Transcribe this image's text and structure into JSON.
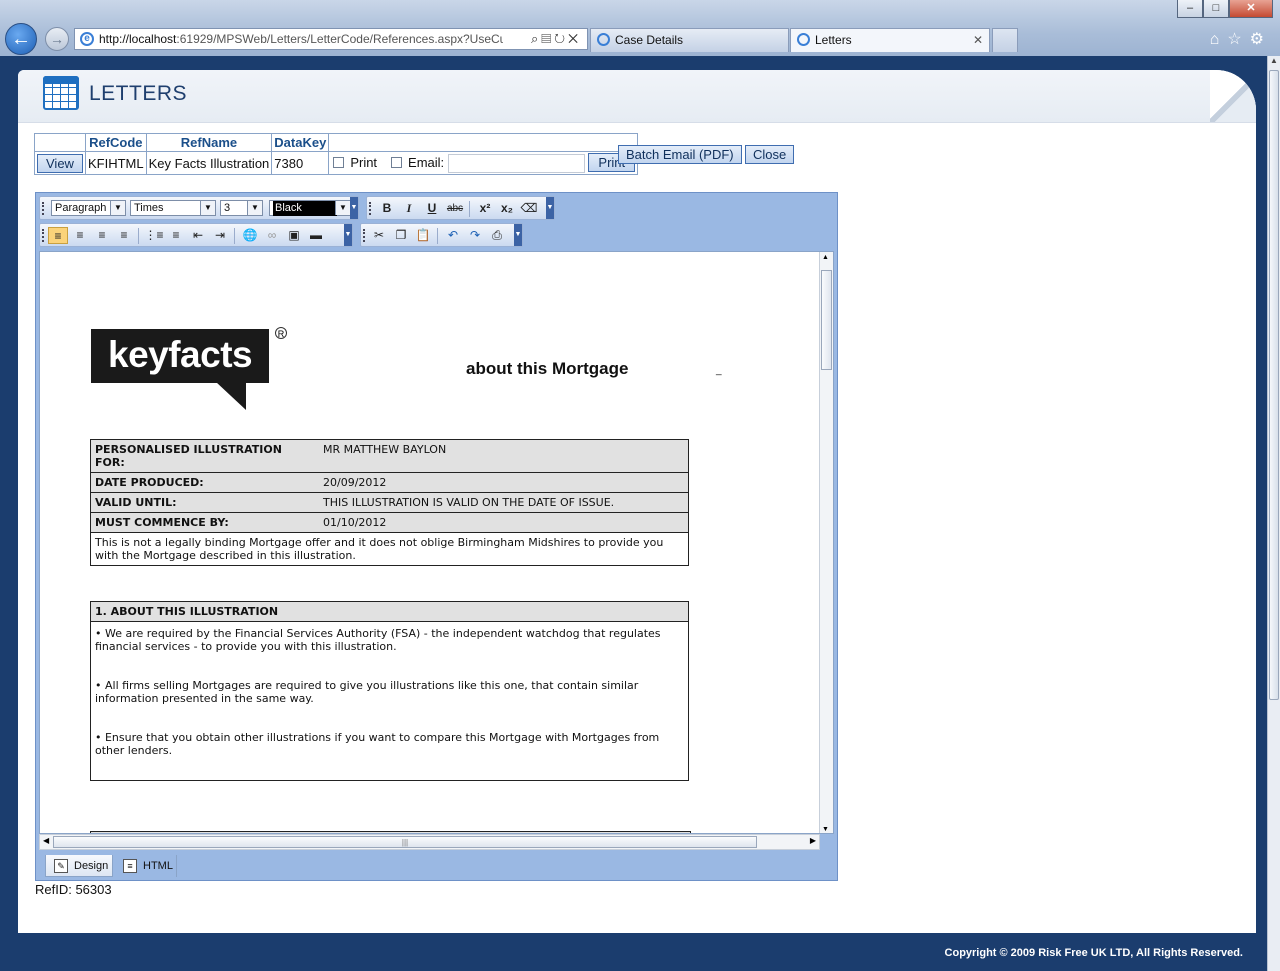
{
  "browser": {
    "url_host": "http://localhost",
    "url_rest": ":61929/MPSWeb/Letters/LetterCode/References.aspx?UseCu",
    "tabs": [
      {
        "label": "Case Details"
      },
      {
        "label": "Letters"
      }
    ],
    "window_controls": {
      "minimize": "–",
      "maximize": "□",
      "close": "✕"
    }
  },
  "header": {
    "title": "LETTERS"
  },
  "ref_table": {
    "columns": [
      "RefCode",
      "RefName",
      "DataKey"
    ],
    "view_button": "View",
    "row": {
      "ref_code": "KFIHTML",
      "ref_name": "Key Facts Illustration",
      "data_key": "7380"
    },
    "print_label": "Print",
    "email_label": "Email:",
    "print_button": "Print"
  },
  "actions": {
    "batch_email": "Batch Email (PDF)",
    "close": "Close"
  },
  "editor": {
    "paragraph_select": "Paragraph",
    "font_select": "Times",
    "size_select": "3",
    "color_select": "Black",
    "modes": [
      "Design",
      "HTML"
    ],
    "icons": {
      "bold": "bold-icon",
      "italic": "italic-icon",
      "underline": "underline-icon",
      "strike": "strikethrough-icon",
      "superscript": "superscript-icon",
      "subscript": "subscript-icon",
      "eraser": "eraser-icon"
    }
  },
  "document": {
    "logo_text": "keyfacts",
    "logo_reg": "R",
    "title": "about this Mortgage",
    "tiny_mark": "_",
    "details": [
      {
        "label": "PERSONALISED ILLUSTRATION FOR:",
        "value": "MR MATTHEW BAYLON"
      },
      {
        "label": "DATE PRODUCED:",
        "value": "20/09/2012"
      },
      {
        "label": "VALID UNTIL:",
        "value": "THIS ILLUSTRATION IS VALID ON THE DATE OF ISSUE."
      },
      {
        "label": "MUST COMMENCE BY:",
        "value": "01/10/2012"
      }
    ],
    "disclaimer": "This is not a legally binding Mortgage offer and it does not oblige Birmingham Midshires to provide you with the Mortgage described in this illustration.",
    "section1": {
      "heading": "1. ABOUT THIS ILLUSTRATION",
      "bullets": [
        "•  We are required by the Financial Services Authority (FSA) - the independent watchdog that regulates financial services - to provide you with this illustration.",
        "•  All firms selling Mortgages are required to give you illustrations like this one, that contain similar information presented in the same way.",
        "•  Ensure that you obtain other illustrations if you want to compare this Mortgage with Mortgages from other lenders."
      ]
    }
  },
  "footer": {
    "ref_id": "RefID: 56303",
    "copyright": "Copyright © 2009 Risk Free UK LTD, All Rights Reserved."
  }
}
